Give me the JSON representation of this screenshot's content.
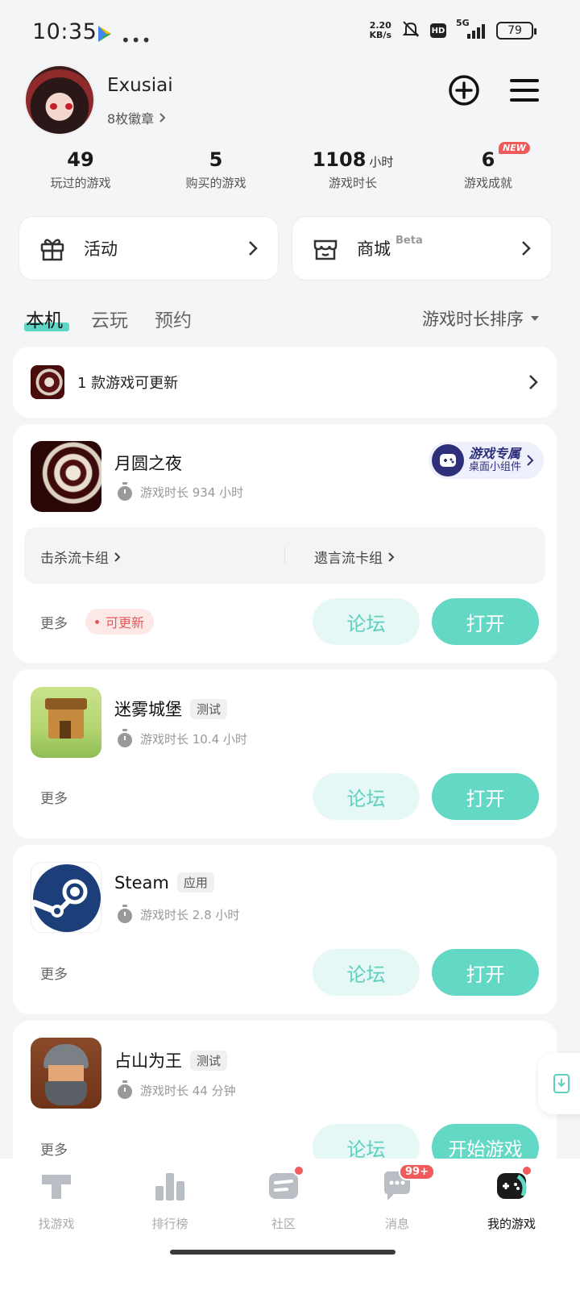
{
  "status_bar": {
    "time": "10:35",
    "net_speed_value": "2.20",
    "net_speed_unit": "KB/s",
    "hd": "HD",
    "network": "5G",
    "battery": "79"
  },
  "profile": {
    "username": "Exusiai",
    "badges": "8枚徽章"
  },
  "stats": [
    {
      "value": "49",
      "unit": "",
      "label": "玩过的游戏"
    },
    {
      "value": "5",
      "unit": "",
      "label": "购买的游戏"
    },
    {
      "value": "1108",
      "unit": "小时",
      "label": "游戏时长"
    },
    {
      "value": "6",
      "unit": "",
      "label": "游戏成就",
      "badge": "NEW"
    }
  ],
  "actions": {
    "activity": "活动",
    "store": "商城",
    "store_beta": "Beta"
  },
  "tabs": {
    "local": "本机",
    "cloud": "云玩",
    "reserve": "预约",
    "sort": "游戏时长排序"
  },
  "update_notice": "1 款游戏可更新",
  "games": [
    {
      "name": "月圆之夜",
      "tag": "",
      "playtime": "游戏时长 934 小时",
      "deck_1": "击杀流卡组",
      "deck_2": "遗言流卡组",
      "more": "更多",
      "update": "可更新",
      "widget_title": "游戏专属",
      "widget_sub": "桌面小组件",
      "forum": "论坛",
      "open": "打开"
    },
    {
      "name": "迷雾城堡",
      "tag": "测试",
      "playtime": "游戏时长 10.4 小时",
      "more": "更多",
      "forum": "论坛",
      "open": "打开"
    },
    {
      "name": "Steam",
      "tag": "应用",
      "playtime": "游戏时长 2.8 小时",
      "more": "更多",
      "forum": "论坛",
      "open": "打开"
    },
    {
      "name": "占山为王",
      "tag": "测试",
      "playtime": "游戏时长 44 分钟",
      "more": "更多",
      "forum": "论坛",
      "open": "开始游戏"
    }
  ],
  "bottom_nav": [
    {
      "label": "找游戏",
      "icon": "find-game-icon"
    },
    {
      "label": "排行榜",
      "icon": "ranking-icon"
    },
    {
      "label": "社区",
      "icon": "community-icon"
    },
    {
      "label": "消息",
      "icon": "message-icon",
      "badge": "99+"
    },
    {
      "label": "我的游戏",
      "icon": "gamepad-icon"
    }
  ],
  "colors": {
    "accent": "#63d8c4",
    "accent_light": "#e6f8f5",
    "red": "#f15b5b",
    "widget_navy": "#2e2f7a"
  }
}
